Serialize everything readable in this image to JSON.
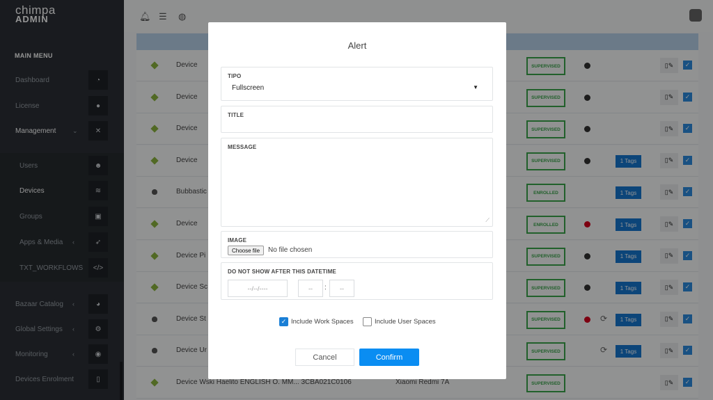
{
  "brand": {
    "line1": "chimpa",
    "line2": "ADMIN"
  },
  "sidebar": {
    "section_title": "MAIN MENU",
    "items": [
      {
        "label": "Dashboard",
        "icon": "gauge-icon"
      },
      {
        "label": "License",
        "icon": "circle-icon"
      },
      {
        "label": "Management",
        "icon": "tools-icon",
        "chevron": "⌄"
      },
      {
        "label": "Users",
        "icon": "users-icon"
      },
      {
        "label": "Devices",
        "icon": "layers-icon"
      },
      {
        "label": "Groups",
        "icon": "groups-icon"
      },
      {
        "label": "Apps & Media",
        "icon": "rocket-icon",
        "chevron": "‹"
      },
      {
        "label": "TXT_WORKFLOWS",
        "icon": "code-icon"
      },
      {
        "label": "Bazaar Catalog",
        "icon": "chart-icon",
        "chevron": "‹"
      },
      {
        "label": "Global Settings",
        "icon": "cogs-icon",
        "chevron": "‹"
      },
      {
        "label": "Monitoring",
        "icon": "eye-icon",
        "chevron": "‹"
      },
      {
        "label": "Devices Enrolment",
        "icon": "tablet-icon"
      }
    ]
  },
  "table": {
    "rows": [
      {
        "os": "android",
        "name": "Device",
        "model": "",
        "status": "SUPERVISED",
        "dot": "dark",
        "sync": false,
        "tags": ""
      },
      {
        "os": "android",
        "name": "Device",
        "model": "",
        "status": "SUPERVISED",
        "dot": "dark",
        "sync": false,
        "tags": ""
      },
      {
        "os": "android",
        "name": "Device",
        "model": "",
        "status": "SUPERVISED",
        "dot": "dark",
        "sync": false,
        "tags": ""
      },
      {
        "os": "android",
        "name": "Device",
        "model": "",
        "status": "SUPERVISED",
        "dot": "dark",
        "sync": false,
        "tags": "1 Tags"
      },
      {
        "os": "apple",
        "name": "Bubbastic",
        "model": "",
        "status": "ENROLLED",
        "dot": "",
        "sync": false,
        "tags": "1 Tags"
      },
      {
        "os": "android",
        "name": "Device",
        "model": "",
        "status": "ENROLLED",
        "dot": "red",
        "sync": false,
        "tags": "1 Tags"
      },
      {
        "os": "android",
        "name": "Device Pi",
        "model": "",
        "status": "SUPERVISED",
        "dot": "dark",
        "sync": false,
        "tags": "1 Tags"
      },
      {
        "os": "android",
        "name": "Device Sc",
        "model": "",
        "status": "SUPERVISED",
        "dot": "dark",
        "sync": false,
        "tags": "1 Tags"
      },
      {
        "os": "apple",
        "name": "Device St",
        "model": "",
        "status": "SUPERVISED",
        "dot": "red",
        "sync": true,
        "tags": "1 Tags"
      },
      {
        "os": "apple",
        "name": "Device Ur",
        "model": "",
        "status": "SUPERVISED",
        "dot": "",
        "sync": true,
        "tags": "1 Tags"
      },
      {
        "os": "android",
        "name": "Device Wski Haelito ENGLISH O. MM... 3CBA021C0106",
        "model": "Xiaomi Redmi 7A",
        "status": "SUPERVISED",
        "dot": "",
        "sync": false,
        "tags": ""
      }
    ]
  },
  "modal": {
    "title": "Alert",
    "tipo_label": "TIPO",
    "tipo_value": "Fullscreen",
    "title_label": "TITLE",
    "title_value": "",
    "message_label": "MESSAGE",
    "message_value": "",
    "image_label": "IMAGE",
    "file_button": "Choose file",
    "file_status": "No file chosen",
    "datetime_label": "DO NOT SHOW AFTER THIS DATETIME",
    "date_placeholder": "--/--/----",
    "hour_placeholder": "--",
    "minute_placeholder": "--",
    "time_separator": ":",
    "include_work_spaces": "Include Work Spaces",
    "include_work_spaces_checked": true,
    "include_user_spaces": "Include User Spaces",
    "include_user_spaces_checked": false,
    "cancel": "Cancel",
    "confirm": "Confirm"
  },
  "colors": {
    "primary": "#0a8df2",
    "success": "#3aa54a",
    "sidebar": "#2b3036",
    "danger": "#d8001e"
  }
}
